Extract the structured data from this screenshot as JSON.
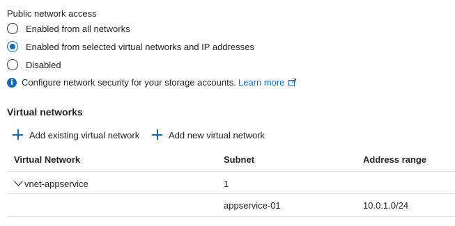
{
  "public_access": {
    "label": "Public network access",
    "options": [
      {
        "label": "Enabled from all networks",
        "checked": false
      },
      {
        "label": "Enabled from selected virtual networks and IP addresses",
        "checked": true
      },
      {
        "label": "Disabled",
        "checked": false
      }
    ],
    "info_text": "Configure network security for your storage accounts.",
    "learn_more": "Learn more"
  },
  "virtual_networks": {
    "heading": "Virtual networks",
    "add_existing": "Add existing virtual network",
    "add_new": "Add new virtual network",
    "columns": [
      "Virtual Network",
      "Subnet",
      "Address range"
    ],
    "group": {
      "name": "vnet-appservice",
      "subnet_count": "1"
    },
    "rows": [
      {
        "vnet": "",
        "subnet": "appservice-01",
        "address_range": "10.0.1.0/24"
      }
    ]
  },
  "colors": {
    "accent": "#0f6cbd",
    "divider": "#e0e0e0"
  }
}
